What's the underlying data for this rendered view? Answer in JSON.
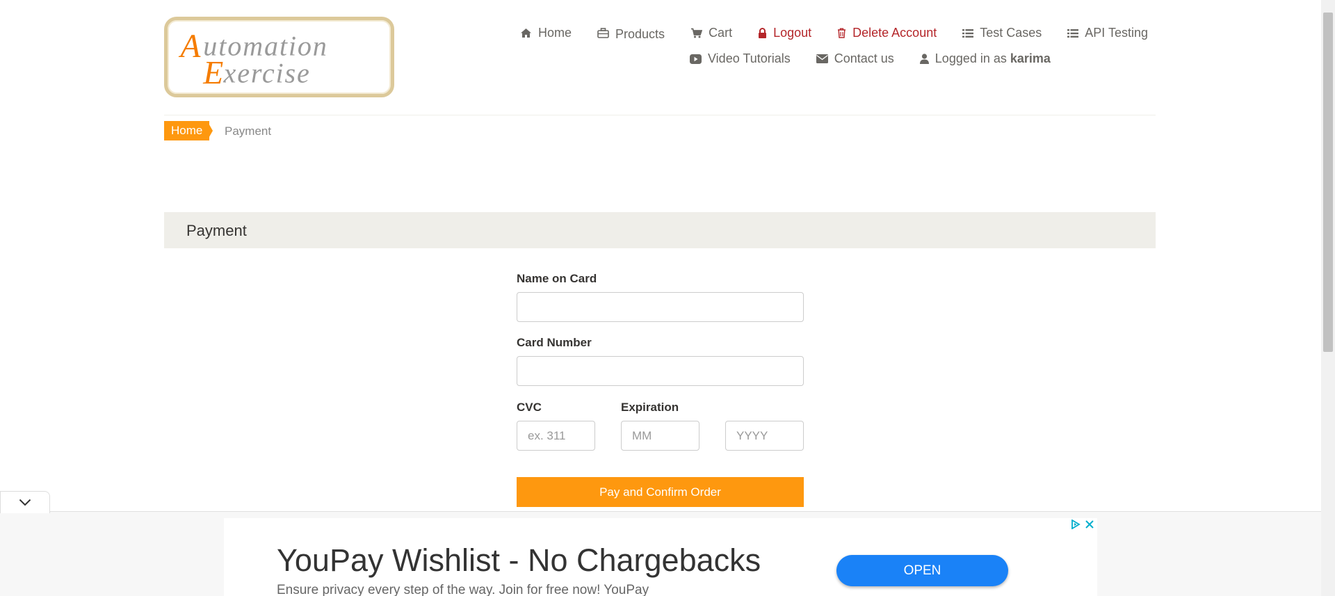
{
  "logo": {
    "line1_initial": "A",
    "line1_rest": "utomation",
    "line2_initial": "E",
    "line2_rest": "xercise"
  },
  "nav": {
    "home": "Home",
    "products": "Products",
    "cart": "Cart",
    "logout": "Logout",
    "delete_account": "Delete Account",
    "test_cases": "Test Cases",
    "api_testing": "API Testing",
    "video_tutorials": "Video Tutorials",
    "contact_us": "Contact us",
    "logged_in_prefix": "Logged in as",
    "username": "karima"
  },
  "breadcrumb": {
    "home": "Home",
    "current": "Payment"
  },
  "payment": {
    "heading": "Payment",
    "name_label": "Name on Card",
    "name_value": "",
    "card_label": "Card Number",
    "card_value": "",
    "cvc_label": "CVC",
    "cvc_placeholder": "ex. 311",
    "expiration_label": "Expiration",
    "month_placeholder": "MM",
    "year_placeholder": "YYYY",
    "submit_label": "Pay and Confirm Order"
  },
  "ad": {
    "title": "YouPay Wishlist - No Chargebacks",
    "subtitle": "Ensure privacy every step of the way. Join for free now! YouPay",
    "cta": "OPEN"
  },
  "colors": {
    "accent": "#fe980f",
    "danger": "#b4262a",
    "text": "#696763",
    "ad_button": "#1a82f7"
  },
  "icons": {
    "home": "home-icon",
    "products": "briefcase-icon",
    "cart": "cart-icon",
    "logout": "lock-icon",
    "delete": "trash-icon",
    "test_cases": "list-icon",
    "api_testing": "list-icon",
    "video": "youtube-icon",
    "contact": "envelope-icon",
    "user": "user-icon",
    "ad_collapse": "chevron-down-icon",
    "ad_info": "adchoices-icon",
    "ad_close": "close-icon"
  }
}
